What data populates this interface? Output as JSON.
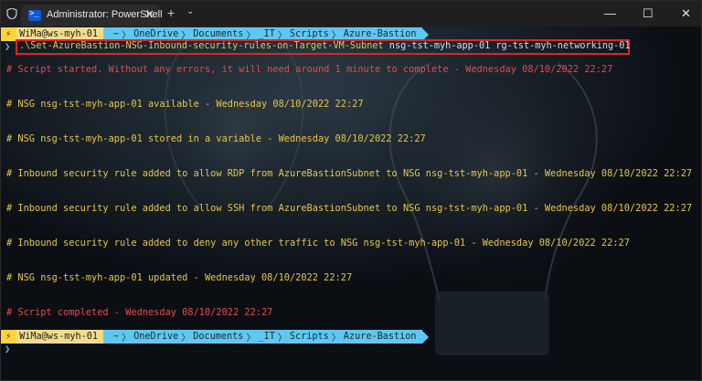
{
  "titlebar": {
    "tab_title": "Administrator: PowerShell",
    "tab_close": "✕",
    "new_tab": "+",
    "tab_dropdown": "⌄",
    "minimize": "—",
    "maximize": "☐",
    "close": "✕"
  },
  "prompt": {
    "bolt": "⚡",
    "user": "WiMa@ws-myh-01",
    "home": "~",
    "path": [
      "OneDrive",
      "Documents",
      "_IT",
      "Scripts",
      "Azure-Bastion"
    ],
    "caret": "❯"
  },
  "command": {
    "script": ".\\Set-AzureBastion-NSG-Inbound-security-rules-on-Target-VM-Subnet",
    "args": " nsg-tst-myh-app-01 rg-tst-myh-networking-01"
  },
  "output": [
    {
      "text": "# Script started. Without any errors, it will need around 1 minute to complete - Wednesday 08/10/2022 22:27",
      "color": "red"
    },
    {
      "text": "# NSG nsg-tst-myh-app-01 available - Wednesday 08/10/2022 22:27",
      "color": "yellow"
    },
    {
      "text": "# NSG nsg-tst-myh-app-01 stored in a variable - Wednesday 08/10/2022 22:27",
      "color": "yellow"
    },
    {
      "text": "# Inbound security rule added to allow RDP from AzureBastionSubnet to NSG nsg-tst-myh-app-01 - Wednesday 08/10/2022 22:27",
      "color": "yellow"
    },
    {
      "text": "# Inbound security rule added to allow SSH from AzureBastionSubnet to NSG nsg-tst-myh-app-01 - Wednesday 08/10/2022 22:27",
      "color": "yellow"
    },
    {
      "text": "# Inbound security rule added to deny any other traffic to NSG nsg-tst-myh-app-01 - Wednesday 08/10/2022 22:27",
      "color": "yellow"
    },
    {
      "text": "# NSG nsg-tst-myh-app-01 updated - Wednesday 08/10/2022 22:27",
      "color": "yellow"
    },
    {
      "text": "# Script completed - Wednesday 08/10/2022 22:27",
      "color": "red"
    }
  ],
  "colors": {
    "accent_red": "#e02424",
    "prompt_yellow": "#ffd43b",
    "prompt_user": "#f2dd8b",
    "prompt_path": "#5ec8f2"
  }
}
